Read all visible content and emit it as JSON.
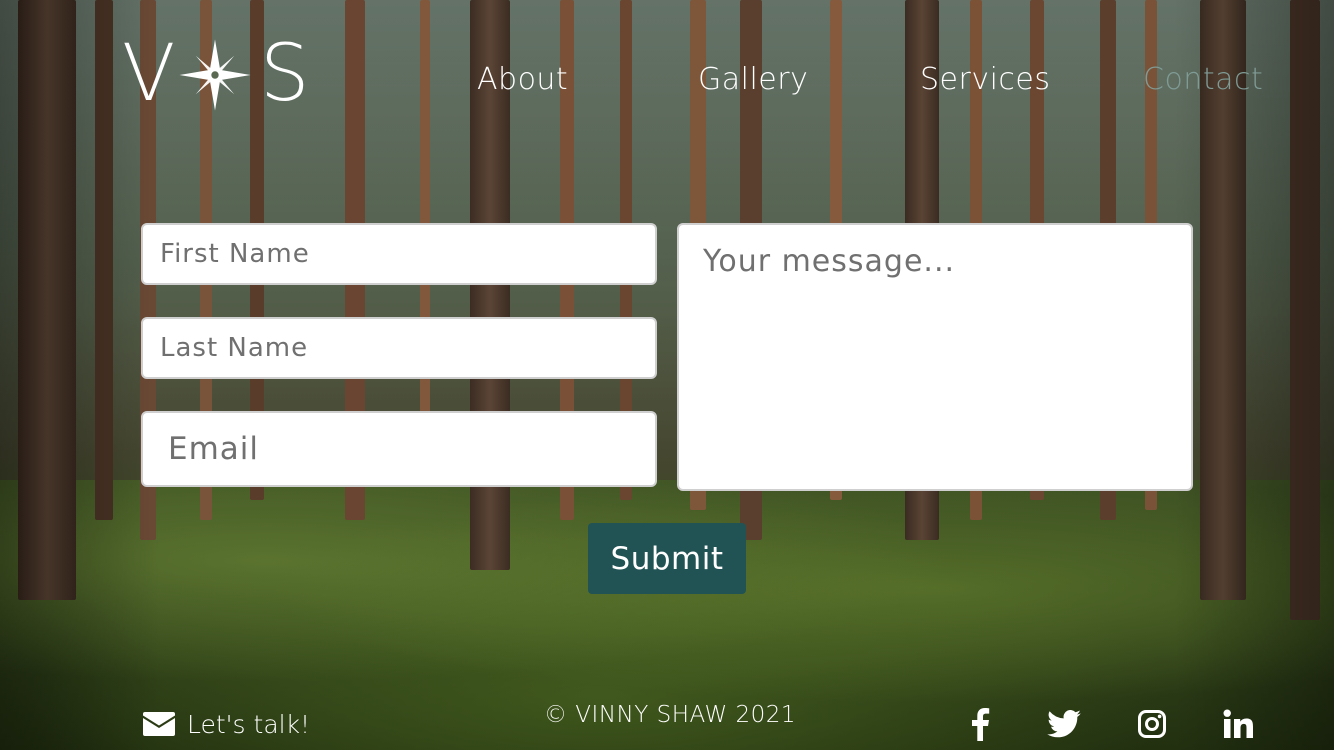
{
  "brand": {
    "logo_left": "V",
    "logo_right": "S",
    "logo_icon": "compass-star-icon"
  },
  "nav": {
    "items": [
      {
        "label": "About"
      },
      {
        "label": "Gallery"
      },
      {
        "label": "Services"
      },
      {
        "label": "Contact",
        "active": true
      }
    ]
  },
  "form": {
    "first_name": {
      "placeholder": "First Name",
      "value": ""
    },
    "last_name": {
      "placeholder": "Last Name",
      "value": ""
    },
    "email": {
      "placeholder": "Email",
      "value": ""
    },
    "message": {
      "placeholder": "Your message...",
      "value": ""
    },
    "submit_label": "Submit"
  },
  "footer": {
    "talk_label": "Let's talk!",
    "talk_icon": "envelope-icon",
    "copyright": "© VINNY SHAW 2021",
    "social": [
      {
        "name": "facebook-icon"
      },
      {
        "name": "twitter-icon"
      },
      {
        "name": "instagram-icon"
      },
      {
        "name": "linkedin-icon"
      }
    ]
  },
  "colors": {
    "accent": "#215355",
    "nav_active": "#7f9b95",
    "text": "#ffffff"
  }
}
